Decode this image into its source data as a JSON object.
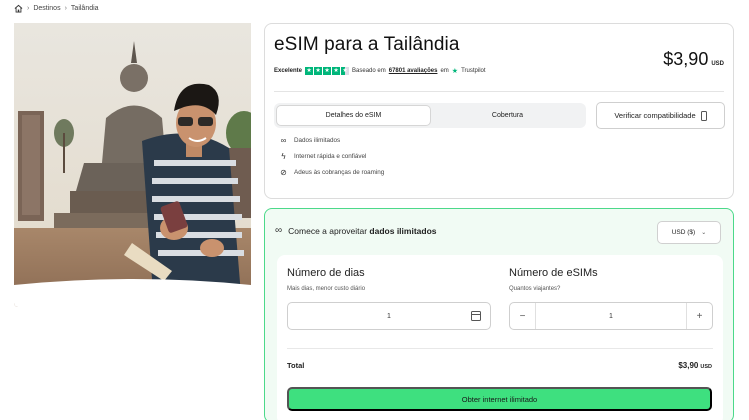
{
  "breadcrumb": {
    "items": [
      "Destinos",
      "Tailândia"
    ]
  },
  "product": {
    "title": "eSIM para a Tailândia",
    "rating_label": "Excelente",
    "rating_stars": 4.5,
    "based_on_prefix": "Baseado em",
    "reviews_link": "67801 avaliações",
    "based_on_suffix": "em",
    "trustpilot": "Trustpilot",
    "price": "$3,90",
    "price_currency": "USD",
    "tabs": [
      {
        "label": "Detalhes do eSIM",
        "active": true
      },
      {
        "label": "Cobertura",
        "active": false
      }
    ],
    "verify_button": "Verificar compatibilidade",
    "features": [
      {
        "icon": "infinity-icon",
        "text": "Dados ilimitados"
      },
      {
        "icon": "bolt-icon",
        "text": "Internet rápida e confiável"
      },
      {
        "icon": "no-roaming-icon",
        "text": "Adeus às cobranças de roaming"
      }
    ]
  },
  "plan": {
    "heading_prefix": "Comece a aproveitar",
    "heading_bold": "dados ilimitados",
    "currency_select": "USD ($)",
    "days": {
      "label": "Número de dias",
      "hint": "Mais dias, menor custo diário",
      "value": "1"
    },
    "esims": {
      "label": "Número de eSIMs",
      "hint": "Quantos viajantes?",
      "value": "1"
    },
    "total_label": "Total",
    "total_value": "$3,90",
    "total_currency": "USD",
    "cta": "Obter internet ilimitado"
  },
  "colors": {
    "brand_green": "#3ee07f",
    "plan_border": "#4cd98a",
    "plan_bg": "#f1fbf4",
    "trustpilot_green": "#00b67a"
  }
}
